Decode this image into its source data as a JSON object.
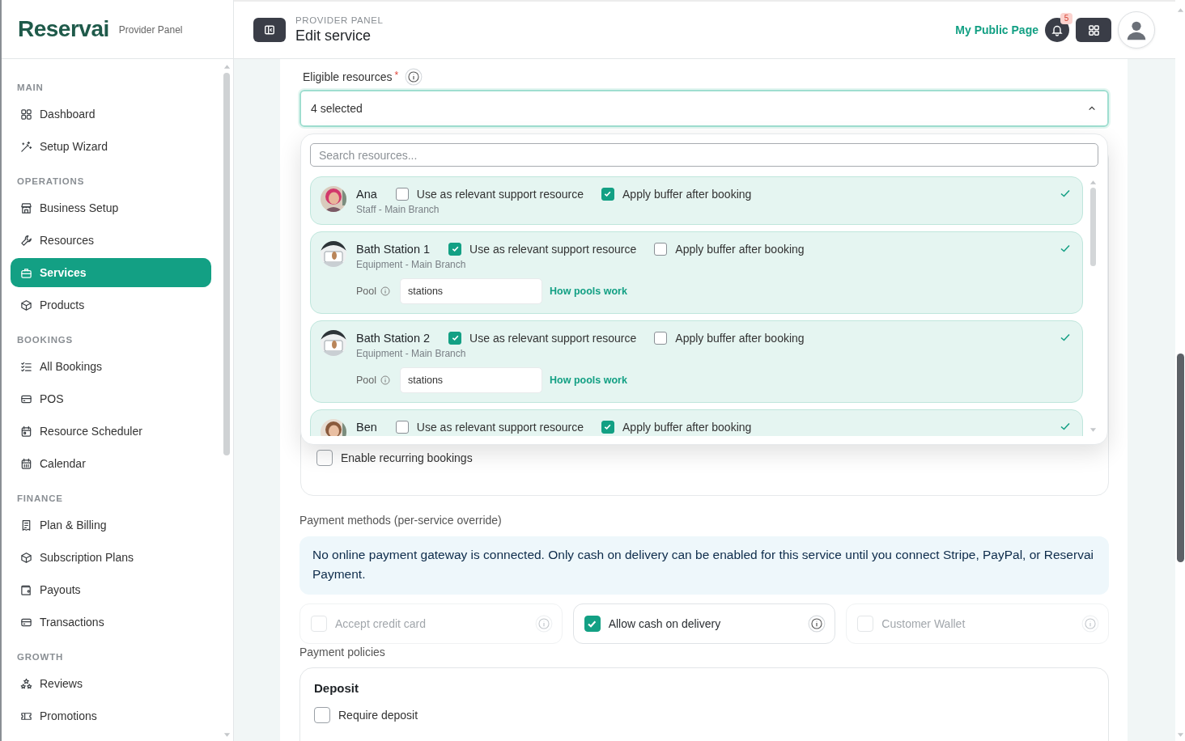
{
  "sidebar": {
    "logo": "Reservai",
    "subtitle": "Provider Panel",
    "sections": [
      {
        "title": "MAIN",
        "items": [
          {
            "label": "Dashboard",
            "selected": false
          },
          {
            "label": "Setup Wizard",
            "selected": false
          }
        ]
      },
      {
        "title": "OPERATIONS",
        "items": [
          {
            "label": "Business Setup",
            "selected": false
          },
          {
            "label": "Resources",
            "selected": false
          },
          {
            "label": "Services",
            "selected": true
          },
          {
            "label": "Products",
            "selected": false
          }
        ]
      },
      {
        "title": "BOOKINGS",
        "items": [
          {
            "label": "All Bookings",
            "selected": false
          },
          {
            "label": "POS",
            "selected": false
          },
          {
            "label": "Resource Scheduler",
            "selected": false
          },
          {
            "label": "Calendar",
            "selected": false
          }
        ]
      },
      {
        "title": "FINANCE",
        "items": [
          {
            "label": "Plan & Billing",
            "selected": false
          },
          {
            "label": "Subscription Plans",
            "selected": false
          },
          {
            "label": "Payouts",
            "selected": false
          },
          {
            "label": "Transactions",
            "selected": false
          }
        ]
      },
      {
        "title": "GROWTH",
        "items": [
          {
            "label": "Reviews",
            "selected": false
          },
          {
            "label": "Promotions",
            "selected": false
          }
        ]
      }
    ]
  },
  "header": {
    "eyebrow": "PROVIDER PANEL",
    "title": "Edit service",
    "public_page_link": "My Public Page",
    "notification_count": "5"
  },
  "eligible_resources": {
    "label": "Eligible resources",
    "required_mark": "*",
    "value": "4 selected",
    "expanded": true,
    "dropdown": {
      "search_placeholder": "Search resources...",
      "items": [
        {
          "name": "Ana",
          "kind": "staff",
          "subtitle": "Staff - Main Branch",
          "support": {
            "label": "Use as relevant support resource",
            "checked": false
          },
          "buffer": {
            "label": "Apply buffer after booking",
            "checked": true
          },
          "selected": true
        },
        {
          "name": "Bath Station 1",
          "kind": "equipment",
          "subtitle": "Equipment - Main Branch",
          "support": {
            "label": "Use as relevant support resource",
            "checked": true
          },
          "buffer": {
            "label": "Apply buffer after booking",
            "checked": false
          },
          "pool": {
            "label": "Pool",
            "value": "stations",
            "link": "How pools work"
          },
          "selected": true
        },
        {
          "name": "Bath Station 2",
          "kind": "equipment",
          "subtitle": "Equipment - Main Branch",
          "support": {
            "label": "Use as relevant support resource",
            "checked": true
          },
          "buffer": {
            "label": "Apply buffer after booking",
            "checked": false
          },
          "pool": {
            "label": "Pool",
            "value": "stations",
            "link": "How pools work"
          },
          "selected": true
        },
        {
          "name": "Ben",
          "kind": "staff",
          "support": {
            "label": "Use as relevant support resource",
            "checked": false
          },
          "buffer": {
            "label": "Apply buffer after booking",
            "checked": true
          },
          "selected": true
        }
      ]
    }
  },
  "recurring": {
    "label": "Enable recurring bookings",
    "checked": false
  },
  "payment_methods": {
    "label": "Payment methods (per-service override)",
    "notice": "No online payment gateway is connected. Only cash on delivery can be enabled for this service until you connect Stripe, PayPal, or Reservai Payment.",
    "options": [
      {
        "label": "Accept credit card",
        "checked": false,
        "disabled": true
      },
      {
        "label": "Allow cash on delivery",
        "checked": true,
        "disabled": false
      },
      {
        "label": "Customer Wallet",
        "checked": false,
        "disabled": true
      }
    ]
  },
  "payment_policies": {
    "label": "Payment policies",
    "deposit": {
      "title": "Deposit",
      "option": {
        "label": "Require deposit",
        "checked": false
      }
    }
  }
}
